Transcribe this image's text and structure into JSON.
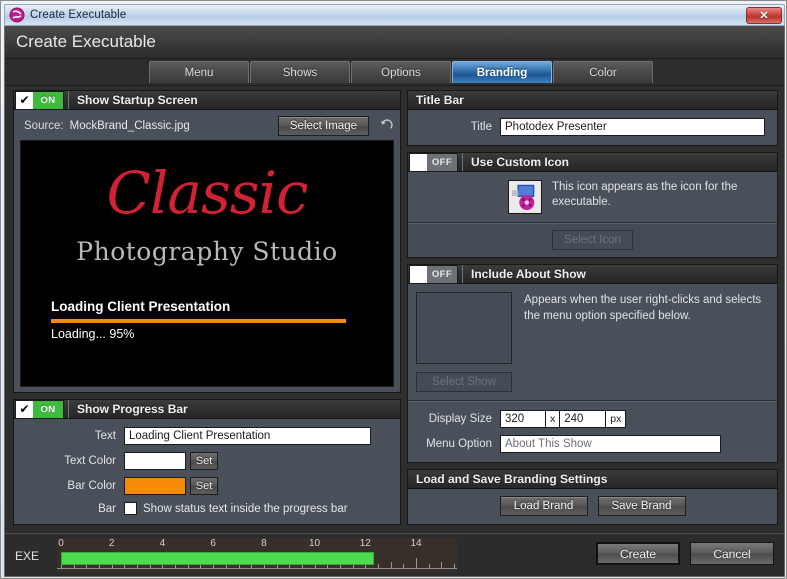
{
  "window": {
    "title": "Create Executable",
    "icon": "photodex-logo-icon",
    "close_label": "✕"
  },
  "header": {
    "title": "Create Executable"
  },
  "tabs": [
    {
      "label": "Menu",
      "active": false
    },
    {
      "label": "Shows",
      "active": false
    },
    {
      "label": "Options",
      "active": false
    },
    {
      "label": "Branding",
      "active": true
    },
    {
      "label": "Color",
      "active": false
    }
  ],
  "startup_screen": {
    "toggle_state": "ON",
    "title": "Show Startup Screen",
    "source_label": "Source:",
    "source_value": "MockBrand_Classic.jpg",
    "select_image_label": "Select Image",
    "reset_icon": "reset-arrow-icon",
    "preview": {
      "brand_script": "Classic",
      "brand_subtitle": "Photography Studio",
      "overlay_title": "Loading Client Presentation",
      "overlay_status": "Loading... 95%",
      "progress_percent": 95,
      "bar_color": "#F58A0B",
      "text_color": "#FFFFFF",
      "script_color": "#CF2233",
      "subtitle_color": "#B9B9B9",
      "background": "#000000"
    }
  },
  "progress_bar": {
    "toggle_state": "ON",
    "title": "Show Progress Bar",
    "text_label": "Text",
    "text_value": "Loading Client Presentation",
    "text_color_label": "Text Color",
    "text_color_value": "#FFFFFF",
    "bar_color_label": "Bar Color",
    "bar_color_value": "#F58A0B",
    "set_label": "Set",
    "bar_label": "Bar",
    "inside_text_label": "Show status text inside the progress bar",
    "inside_text_checked": false
  },
  "title_bar_group": {
    "title": "Title Bar",
    "title_label": "Title",
    "title_value": "Photodex Presenter"
  },
  "custom_icon": {
    "toggle_state": "OFF",
    "title": "Use Custom Icon",
    "icon_name": "executable-thumbnail-icon",
    "description": "This icon appears as the icon for the executable.",
    "select_icon_label": "Select Icon",
    "select_icon_disabled": true
  },
  "about_show": {
    "toggle_state": "OFF",
    "title": "Include About Show",
    "description": "Appears when the user right-clicks and selects the menu option specified below.",
    "select_show_label": "Select Show",
    "select_show_disabled": true,
    "display_size_label": "Display Size",
    "display_width": "320",
    "display_size_x": "x",
    "display_height": "240",
    "display_unit": "px",
    "menu_option_label": "Menu Option",
    "menu_option_value": "About This Show"
  },
  "branding_settings": {
    "title": "Load and Save Branding Settings",
    "load_label": "Load Brand",
    "save_label": "Save Brand"
  },
  "bottom": {
    "exe_label": "EXE",
    "timeline_ticks": [
      "0",
      "2",
      "4",
      "6",
      "8",
      "10",
      "12",
      "14"
    ],
    "timeline_fill_percent": 86,
    "create_label": "Create",
    "cancel_label": "Cancel"
  }
}
